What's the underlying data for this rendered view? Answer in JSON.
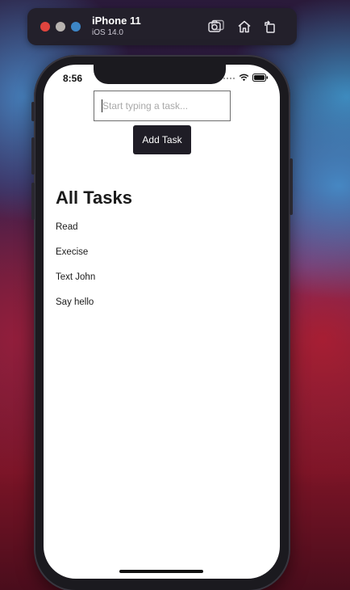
{
  "simulator": {
    "device_name": "iPhone 11",
    "os_version": "iOS 14.0",
    "traffic_colors": [
      "#e0443e",
      "#b8b3b0",
      "#3d86c6"
    ],
    "buttons": {
      "screenshot": "screenshot-icon",
      "home": "home-icon",
      "rotate": "rotate-icon"
    }
  },
  "status_bar": {
    "time": "8:56"
  },
  "app": {
    "input_placeholder": "Start typing a task...",
    "input_value": "",
    "add_button_label": "Add Task",
    "section_title": "All Tasks",
    "tasks": [
      "Read",
      "Execise",
      "Text John",
      "Say hello"
    ]
  },
  "colors": {
    "button_bg": "#1f1d26",
    "button_text": "#ffffff",
    "input_border": "#6e6e6e"
  }
}
